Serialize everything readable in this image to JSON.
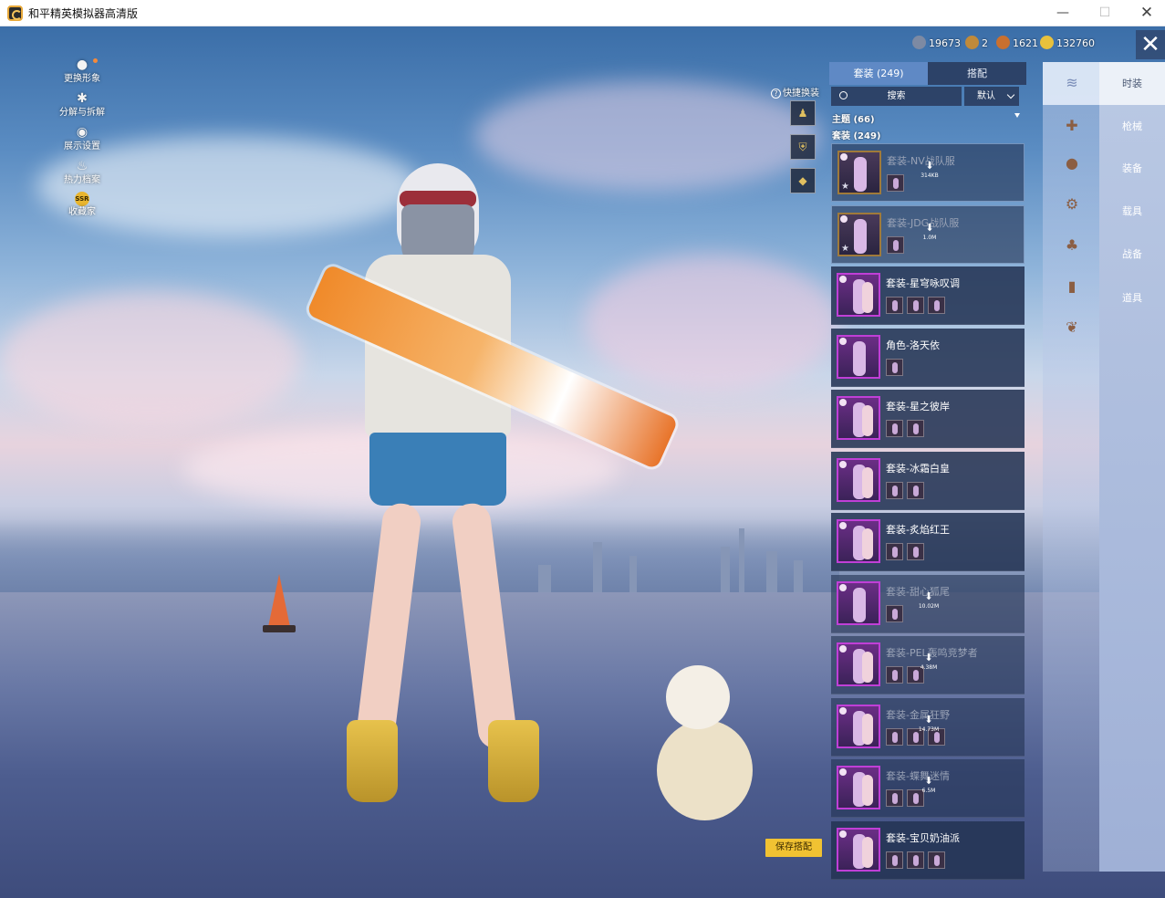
{
  "window": {
    "title": "和平精英模拟器高清版",
    "min_glyph": "—",
    "max_glyph": "☐",
    "close_glyph": "✕"
  },
  "left_menu": [
    {
      "label": "更换形象",
      "icon": "person-icon",
      "glyph": "●"
    },
    {
      "label": "分解与拆解",
      "icon": "puzzle-icon",
      "glyph": "✱"
    },
    {
      "label": "展示设置",
      "icon": "eye-icon",
      "glyph": "◉"
    },
    {
      "label": "热力档案",
      "icon": "flame-icon",
      "glyph": "♨"
    },
    {
      "label": "收藏家",
      "icon": "collector-badge-icon",
      "badge": "SSR"
    }
  ],
  "currencies": [
    {
      "value": "19673",
      "icon": "gear-token-icon",
      "color": "#7d8aa3"
    },
    {
      "value": "2",
      "icon": "honor-token-icon",
      "color": "#c08a3a"
    },
    {
      "value": "1621",
      "icon": "coupon-token-icon",
      "color": "#c9702f"
    },
    {
      "value": "132760",
      "icon": "coin-icon",
      "color": "#e8c13c"
    }
  ],
  "quick_swap": {
    "label": "快捷换装",
    "help_glyph": "?"
  },
  "quick_slots": [
    {
      "icon": "outfit-slot-icon",
      "glyph": "♟"
    },
    {
      "icon": "helmet-slot-icon",
      "glyph": "⛨"
    },
    {
      "icon": "vehicle-slot-icon",
      "glyph": "◆"
    }
  ],
  "panel": {
    "tabs": [
      "套装 (249)",
      "搭配"
    ],
    "search": {
      "placeholder": "搜索"
    },
    "sort": {
      "selected": "默认"
    },
    "groups": [
      "主题 (66)",
      "套装 (249)"
    ]
  },
  "items": [
    {
      "name": "套装-NV战队服",
      "subs": 1,
      "download": "314KB",
      "thumb": "gold",
      "star": true
    },
    {
      "name": "套装-JDG战队服",
      "subs": 1,
      "download": "1.0M",
      "thumb": "gold",
      "star": true
    },
    {
      "name": "套装-星穹咏叹调",
      "subs": 3
    },
    {
      "name": "角色-洛天依",
      "subs": 1
    },
    {
      "name": "套装-星之彼岸",
      "subs": 2
    },
    {
      "name": "套装-冰霜白皇",
      "subs": 2
    },
    {
      "name": "套装-炙焰红王",
      "subs": 2
    },
    {
      "name": "套装-甜心狐尾",
      "subs": 1,
      "download": "10.02M"
    },
    {
      "name": "套装-PEL轰鸣竞梦者",
      "subs": 2,
      "download": "4.38M"
    },
    {
      "name": "套装-金属狂野",
      "subs": 3,
      "download": "14.73M"
    },
    {
      "name": "套装-蝶舞迷情",
      "subs": 2,
      "download": "6.5M"
    },
    {
      "name": "套装-宝贝奶油派",
      "subs": 3
    }
  ],
  "save_button": "保存搭配",
  "categories": [
    {
      "label": "时装",
      "icon": "outfit-icon",
      "glyph": "≋"
    },
    {
      "label": "枪械",
      "icon": "gun-icon",
      "glyph": "✚"
    },
    {
      "label": "装备",
      "icon": "helmet-icon",
      "glyph": "●"
    },
    {
      "label": "载具",
      "icon": "vehicle-icon",
      "glyph": "⚙"
    },
    {
      "label": "战备",
      "icon": "parachute-icon",
      "glyph": "♣"
    },
    {
      "label": "道具",
      "icon": "item-box-icon",
      "glyph": "▮"
    },
    {
      "label": "",
      "icon": "wings-icon",
      "glyph": "❦"
    }
  ],
  "close_panel_glyph": "✕",
  "download_glyph": "⬇",
  "star_glyph": "★"
}
